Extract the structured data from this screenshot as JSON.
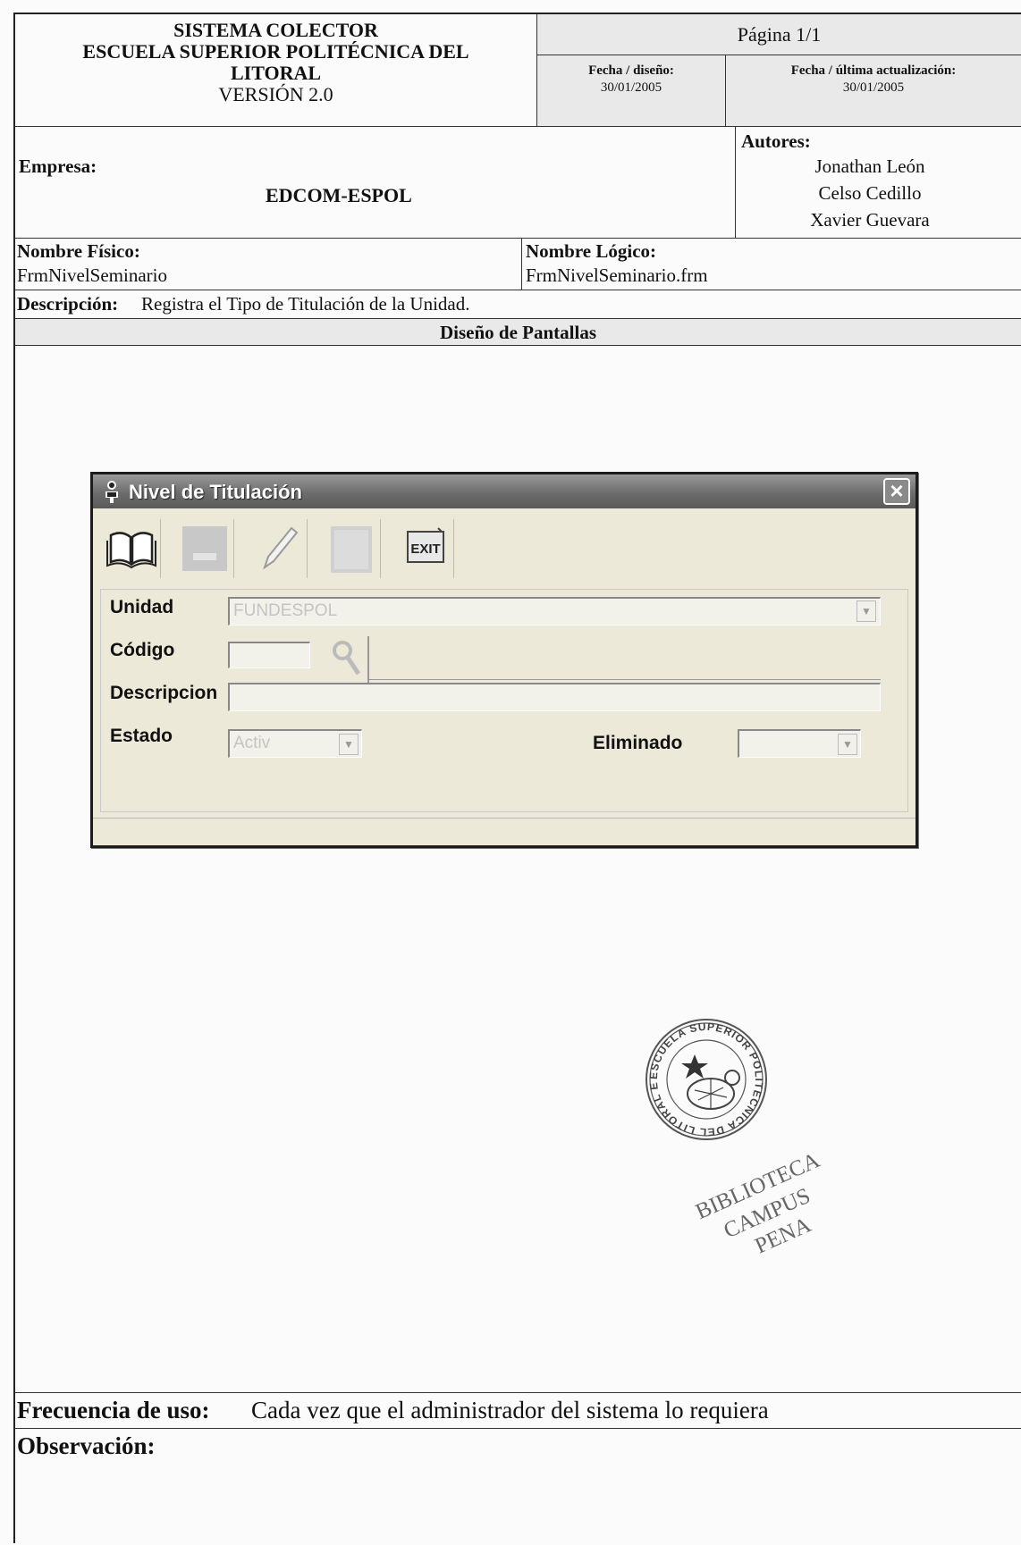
{
  "header": {
    "system_line1": "SISTEMA COLECTOR",
    "system_line2": "ESCUELA SUPERIOR POLITÉCNICA DEL",
    "system_line3": "LITORAL",
    "version": "VERSIÓN 2.0",
    "page": "Página 1/1",
    "design_date_label": "Fecha / diseño:",
    "design_date": "30/01/2005",
    "update_date_label": "Fecha / última actualización:",
    "update_date": "30/01/2005"
  },
  "company": {
    "label": "Empresa:",
    "value": "EDCOM-ESPOL",
    "authors_label": "Autores:",
    "authors": [
      "Jonathan León",
      "Celso Cedillo",
      "Xavier Guevara"
    ]
  },
  "names": {
    "physical_label": "Nombre Físico:",
    "physical_value": "FrmNivelSeminario",
    "logical_label": "Nombre Lógico:",
    "logical_value": "FrmNivelSeminario.frm"
  },
  "description": {
    "label": "Descripción:",
    "value": "Registra el Tipo de Titulación de la Unidad."
  },
  "section_title": "Diseño de Pantallas",
  "window": {
    "title": "Nivel de Titulación",
    "toolbar": [
      "book-icon",
      "save-icon",
      "edit-icon",
      "delete-icon",
      "exit-icon"
    ],
    "exit_label": "EXIT",
    "fields": {
      "unidad_label": "Unidad",
      "unidad_value": "FUNDESPOL",
      "codigo_label": "Código",
      "descripcion_label": "Descripcion",
      "estado_label": "Estado",
      "estado_value": "Activ",
      "eliminado_label": "Eliminado"
    }
  },
  "stamp": {
    "ring_text": "ESCUELA SUPERIOR POLITECNICA DEL LITORAL ESPOL",
    "line1": "BIBLIOTECA",
    "line2": "CAMPUS",
    "line3": "PENA"
  },
  "footer": {
    "frequency_label": "Frecuencia de uso:",
    "frequency_value": "Cada vez que el administrador del sistema lo requiera",
    "observation_label": "Observación:"
  }
}
